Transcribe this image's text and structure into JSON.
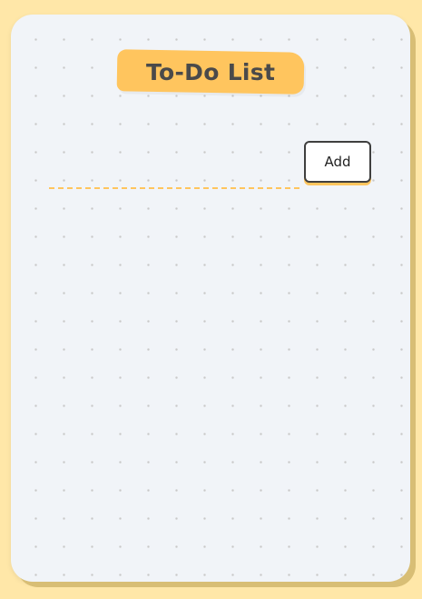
{
  "app": {
    "title": "To-Do List"
  },
  "form": {
    "input_value": "",
    "input_placeholder": "",
    "add_label": "Add"
  },
  "todos": [],
  "colors": {
    "page_background": "#ffe7a8",
    "card_background": "#f1f4f8",
    "accent": "#ffc55e",
    "text_dark": "#4a4a4a",
    "button_border": "#3f3f3f"
  }
}
